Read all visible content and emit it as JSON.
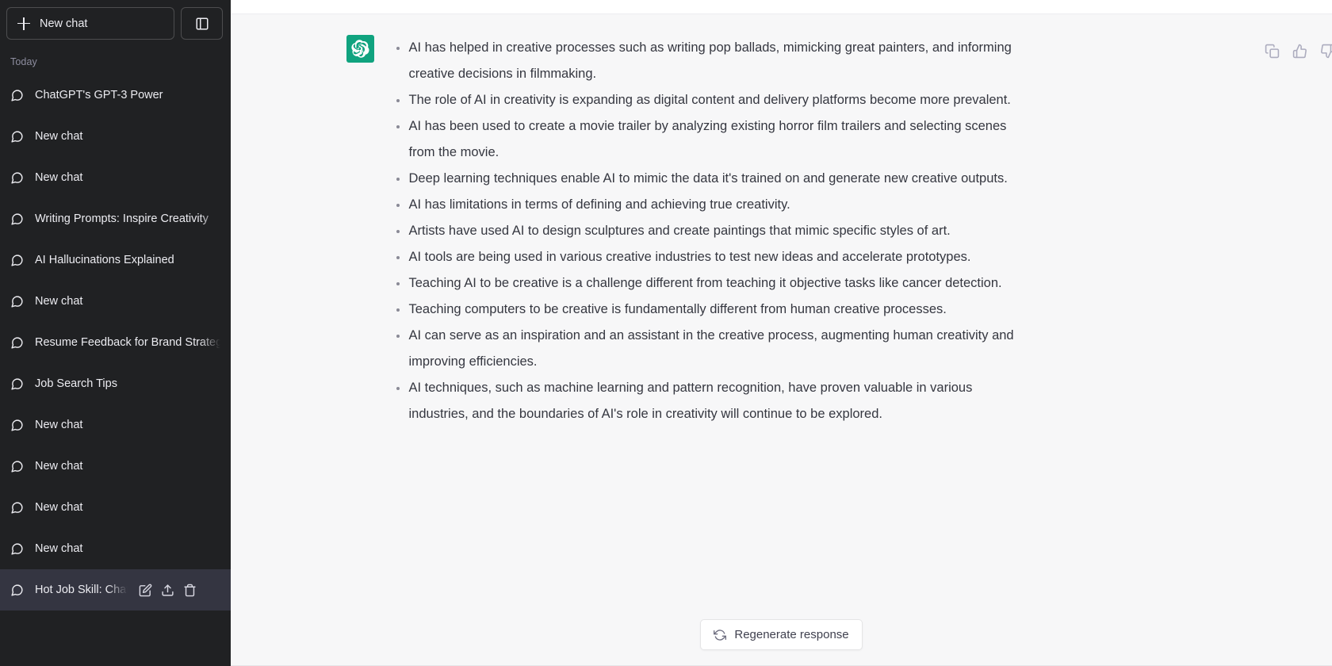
{
  "sidebar": {
    "new_chat_label": "New chat",
    "toggle_icon": "sidebar-panel-icon",
    "section_label": "Today",
    "items": [
      {
        "title": "ChatGPT's GPT-3 Power",
        "active": false
      },
      {
        "title": "New chat",
        "active": false
      },
      {
        "title": "New chat",
        "active": false
      },
      {
        "title": "Writing Prompts: Inspire Creativity",
        "active": false
      },
      {
        "title": "AI Hallucinations Explained",
        "active": false
      },
      {
        "title": "New chat",
        "active": false
      },
      {
        "title": "Resume Feedback for Brand Strategy",
        "active": false
      },
      {
        "title": "Job Search Tips",
        "active": false
      },
      {
        "title": "New chat",
        "active": false
      },
      {
        "title": "New chat",
        "active": false
      },
      {
        "title": "New chat",
        "active": false
      },
      {
        "title": "New chat",
        "active": false
      },
      {
        "title": "Hot Job Skill: ChatGPT",
        "active": true
      }
    ],
    "active_item_actions": [
      {
        "icon": "edit-pencil-icon",
        "label": "Rename"
      },
      {
        "icon": "share-upload-icon",
        "label": "Share"
      },
      {
        "icon": "trash-delete-icon",
        "label": "Delete"
      }
    ]
  },
  "message": {
    "avatar_icon": "openai-logo-icon",
    "avatar_color": "#10a37f",
    "bullets": [
      "AI has helped in creative processes such as writing pop ballads, mimicking great painters, and informing creative decisions in filmmaking.",
      "The role of AI in creativity is expanding as digital content and delivery platforms become more prevalent.",
      "AI has been used to create a movie trailer by analyzing existing horror film trailers and selecting scenes from the movie.",
      "Deep learning techniques enable AI to mimic the data it's trained on and generate new creative outputs.",
      "AI has limitations in terms of defining and achieving true creativity.",
      "Artists have used AI to design sculptures and create paintings that mimic specific styles of art.",
      "AI tools are being used in various creative industries to test new ideas and accelerate prototypes.",
      "Teaching AI to be creative is a challenge different from teaching it objective tasks like cancer detection.",
      "Teaching computers to be creative is fundamentally different from human creative processes.",
      "AI can serve as an inspiration and an assistant in the creative process, augmenting human creativity and improving efficiencies.",
      "AI techniques, such as machine learning and pattern recognition, have proven valuable in various industries, and the boundaries of AI's role in creativity will continue to be explored."
    ],
    "actions": [
      {
        "icon": "copy-clipboard-icon",
        "label": "Copy"
      },
      {
        "icon": "thumbs-up-icon",
        "label": "Good response"
      },
      {
        "icon": "thumbs-down-icon",
        "label": "Bad response"
      }
    ]
  },
  "footer": {
    "regenerate_label": "Regenerate response",
    "regenerate_icon": "refresh-icon"
  }
}
